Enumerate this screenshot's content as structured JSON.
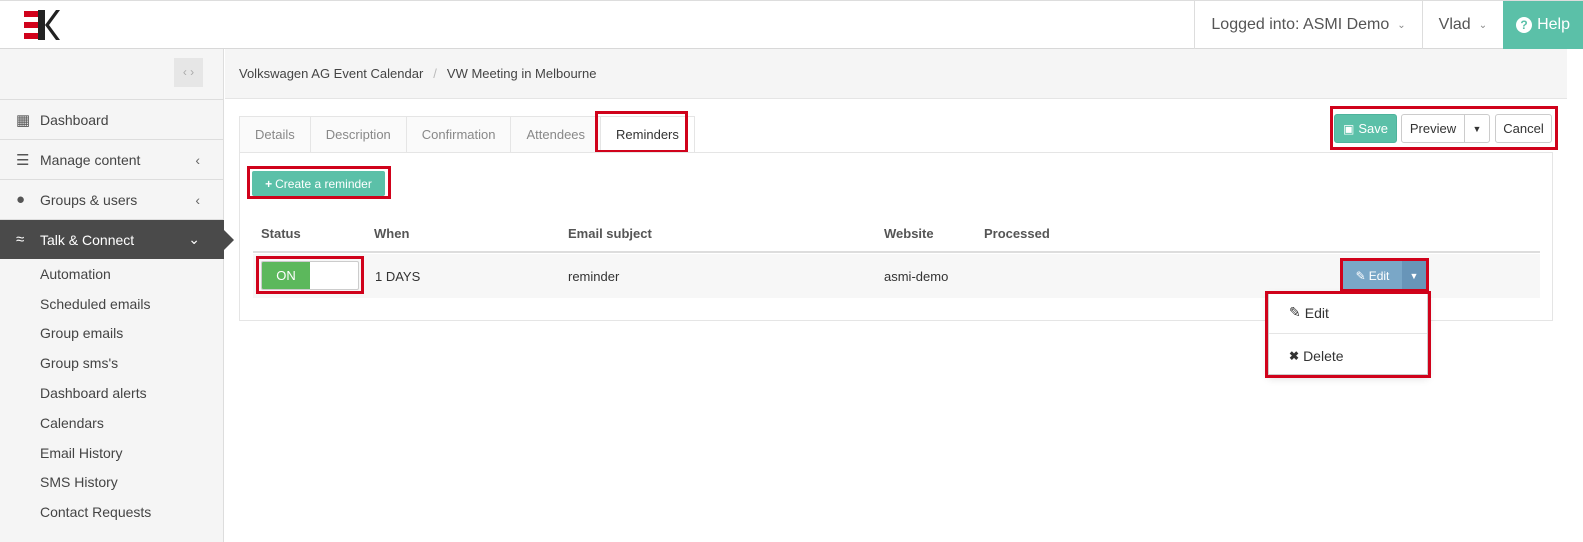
{
  "header": {
    "logged_into": "Logged into: ASMI Demo",
    "user": "Vlad",
    "help": "Help",
    "logo_colors": {
      "red": "#d0021b",
      "dark": "#222222"
    }
  },
  "sidebar": {
    "collapse_glyph": "‹ ›",
    "items": [
      {
        "label": "Dashboard",
        "icon": "grid-icon"
      },
      {
        "label": "Manage content",
        "icon": "layers-icon"
      },
      {
        "label": "Groups & users",
        "icon": "user-icon"
      },
      {
        "label": "Talk & Connect",
        "icon": "wifi-icon",
        "active": true
      }
    ],
    "subitems": [
      "Automation",
      "Scheduled emails",
      "Group emails",
      "Group sms's",
      "Dashboard alerts",
      "Calendars",
      "Email History",
      "SMS History",
      "Contact Requests"
    ]
  },
  "breadcrumb": {
    "parent": "Volkswagen AG Event Calendar",
    "current": "VW Meeting in Melbourne"
  },
  "tabs": [
    "Details",
    "Description",
    "Confirmation",
    "Attendees",
    "Reminders"
  ],
  "active_tab": "Reminders",
  "actions": {
    "save": "Save",
    "preview": "Preview",
    "cancel": "Cancel"
  },
  "create_reminder": "Create a reminder",
  "table": {
    "headers": [
      "Status",
      "When",
      "Email subject",
      "Website",
      "Processed"
    ],
    "rows": [
      {
        "status": "ON",
        "when": "1 DAYS",
        "email_subject": "reminder",
        "website": "asmi-demo",
        "processed": ""
      }
    ],
    "row_action": "Edit"
  },
  "dropdown": {
    "edit": "Edit",
    "delete": "Delete"
  },
  "colors": {
    "accent": "#5bc0a8",
    "highlight": "#d0021b",
    "toggle_on": "#5cb85c",
    "edit_button": "#7aa7c7"
  }
}
